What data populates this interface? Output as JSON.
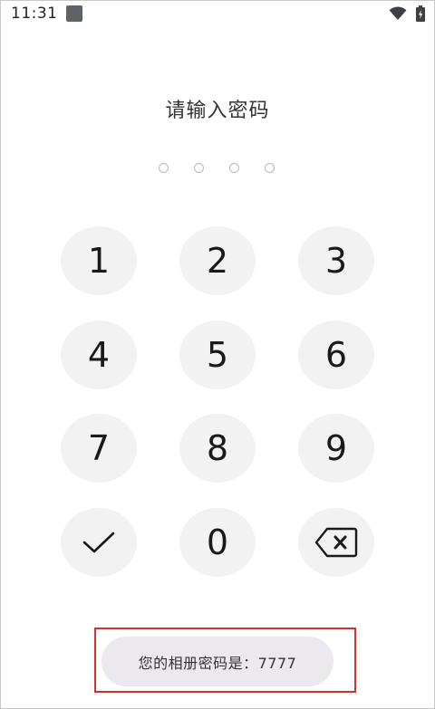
{
  "status_bar": {
    "time": "11:31",
    "icons": [
      "notification-icon",
      "wifi-icon",
      "battery-charging-icon"
    ]
  },
  "title": "请输入密码",
  "pin": {
    "length": 4,
    "entered": 0
  },
  "keypad": {
    "keys": [
      "1",
      "2",
      "3",
      "4",
      "5",
      "6",
      "7",
      "8",
      "9",
      "confirm",
      "0",
      "backspace"
    ],
    "confirm_icon": "checkmark-icon",
    "backspace_icon": "backspace-icon"
  },
  "toast": {
    "text": "您的相册密码是：7777"
  },
  "colors": {
    "key_background": "#f2f2f2",
    "toast_background": "#ebe8ee",
    "highlight_border": "#d9302c",
    "pin_dot_border": "#b9b9b9"
  }
}
